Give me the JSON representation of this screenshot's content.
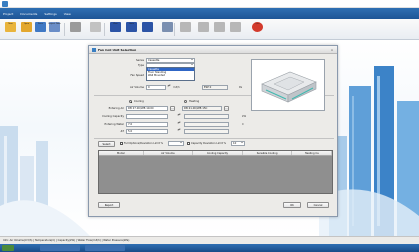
{
  "app": {
    "menus": [
      "Project",
      "Documents",
      "Settings",
      "View"
    ]
  },
  "toolbar": {
    "buttons": [
      {
        "label": "New",
        "icon": "new-file-icon",
        "color": "#e9b43c"
      },
      {
        "label": "Open",
        "icon": "open-folder-icon",
        "color": "#e3a72e"
      },
      {
        "label": "Save",
        "icon": "save-icon",
        "color": "#3f78c4"
      },
      {
        "label": "Project Data",
        "icon": "project-data-icon",
        "color": "#6a8dc7"
      },
      {
        "label": "",
        "icon": "tools-icon",
        "color": "#9b9b9b"
      },
      {
        "label": "",
        "icon": "wizard-icon",
        "color": "#c2c2c2"
      },
      {
        "label": "Plan",
        "icon": "plan-icon",
        "color": "#2c54a6"
      },
      {
        "label": "Units",
        "icon": "units-icon",
        "color": "#2c54a6"
      },
      {
        "label": "",
        "icon": "equipment-icon",
        "color": "#2c54a6"
      },
      {
        "label": "",
        "icon": "outdoor-unit-icon",
        "color": "#7a8fb0"
      },
      {
        "label": "",
        "icon": "print-icon",
        "color": "#b7b7b7"
      },
      {
        "label": "",
        "icon": "report-icon",
        "color": "#b7b7b7"
      },
      {
        "label": "",
        "icon": "delete-icon",
        "color": "#b7b7b7"
      },
      {
        "label": "",
        "icon": "info-icon",
        "color": "#b7b7b7"
      },
      {
        "label": "Quit",
        "icon": "quit-icon",
        "color": "#d33a2c"
      }
    ]
  },
  "dialog": {
    "title": "Fan Coil Unit Selection",
    "close": "×",
    "series_label": "Series",
    "series_value": "Cassette",
    "type_label": "Type",
    "type_options": [
      "Cassette",
      "Floor Standing",
      "Wall Mounted"
    ],
    "fan_speed_label": "Fan Speed",
    "air_volume_label": "Air Volume",
    "air_volume_value": "0",
    "air_volume_unit": "m3/h",
    "esp_value": "ESP 0",
    "esp_unit": "Pa",
    "cooling_label": "Cooling",
    "heating_label": "Heating",
    "entering_air_label": "Entering Air",
    "entering_air_cooling": "DB 27.0C/WB 19.0C",
    "entering_air_heating": "DB 21.0C/WB 15C",
    "cooling_capacity_label": "Cooling Capacity",
    "cooling_capacity_unit": "kW",
    "entering_water_label": "Entering Water",
    "entering_water_value": "7.0",
    "entering_water_unit": "C",
    "dt_label": "ΔT",
    "dt_value": "5.0",
    "select_button": "Select",
    "full_options_label": "Full Options/Deviation Limit %",
    "capacity_deviation_label": "Capacity Deviation Limit %",
    "capacity_deviation_value": "10",
    "table_headers": [
      "Model",
      "Air Volume",
      "Cooling Capacity",
      "Sensible Cooling",
      "Heating Ca"
    ],
    "report_button": "Report",
    "ok_button": "OK",
    "cancel_button": "Cancel"
  },
  "statusbar": {
    "text": "Info: Air Volume(m3/h) | Temperature(C) | Capacity(kW) | Water Flow(m3/h) | Water Pressure(kPa)"
  }
}
